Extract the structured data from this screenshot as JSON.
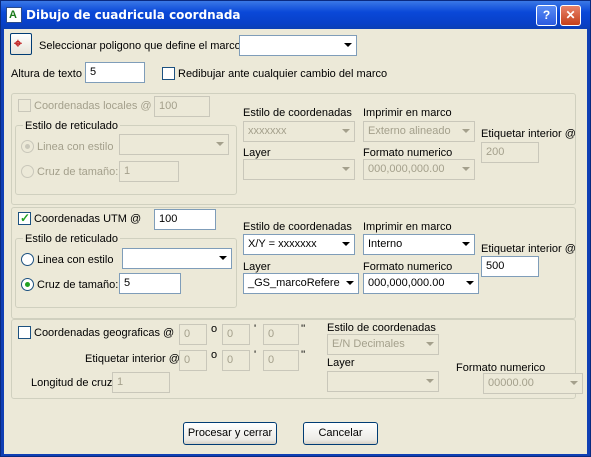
{
  "window": {
    "title": "Dibujo de cuadricula coordnada",
    "help_label": "?",
    "close_label": "✕",
    "app_icon_glyph": "A"
  },
  "top": {
    "select_polygon_label": "Seleccionar poligono que define el marco",
    "select_polygon_value": "",
    "text_height_label": "Altura de texto",
    "text_height_value": "5",
    "redraw_label": "Redibujar ante cualquier cambio del marco",
    "redraw_checked": false
  },
  "local": {
    "enabled_label": "Coordenadas locales @",
    "enabled_checked": false,
    "spacing_value": "100",
    "grid_style_label": "Estilo de reticulado",
    "line_style_label": "Linea con estilo",
    "line_style_value": "",
    "cross_size_label": "Cruz de tamaño:",
    "cross_size_value": "1",
    "coord_style_label": "Estilo de coordenadas",
    "coord_style_value": "xxxxxxx",
    "print_frame_label": "Imprimir en marco",
    "print_frame_value": "Externo alineado",
    "inner_label_label": "Etiquetar interior @",
    "inner_label_value": "200",
    "layer_label": "Layer",
    "layer_value": "",
    "number_format_label": "Formato numerico",
    "number_format_value": "000,000,000.00"
  },
  "utm": {
    "enabled_label": "Coordenadas UTM @",
    "enabled_checked": true,
    "spacing_value": "100",
    "grid_style_label": "Estilo de reticulado",
    "line_style_label": "Linea con estilo",
    "line_style_value": "",
    "cross_size_label": "Cruz de tamaño:",
    "cross_size_value": "5",
    "coord_style_label": "Estilo de coordenadas",
    "coord_style_value": "X/Y = xxxxxxx",
    "print_frame_label": "Imprimir en marco",
    "print_frame_value": "Interno",
    "inner_label_label": "Etiquetar interior @",
    "inner_label_value": "500",
    "layer_label": "Layer",
    "layer_value": "_GS_marcoRefere",
    "number_format_label": "Formato numerico",
    "number_format_value": "000,000,000.00"
  },
  "geo": {
    "enabled_label": "Coordenadas geograficas @",
    "enabled_checked": false,
    "deg1": "0",
    "min1": "0",
    "sec1": "0",
    "inner_label_label": "Etiquetar interior @",
    "deg2": "0",
    "min2": "0",
    "sec2": "0",
    "deg_mark": "o",
    "min_mark": "'",
    "sec_mark": "''",
    "cross_length_label": "Longitud de cruz",
    "cross_length_value": "1",
    "coord_style_label": "Estilo de coordenadas",
    "coord_style_value": "E/N Decimales",
    "layer_label": "Layer",
    "layer_value": "",
    "number_format_label": "Formato numerico",
    "number_format_value": "00000.00"
  },
  "footer": {
    "process_label": "Procesar y cerrar",
    "cancel_label": "Cancelar"
  }
}
